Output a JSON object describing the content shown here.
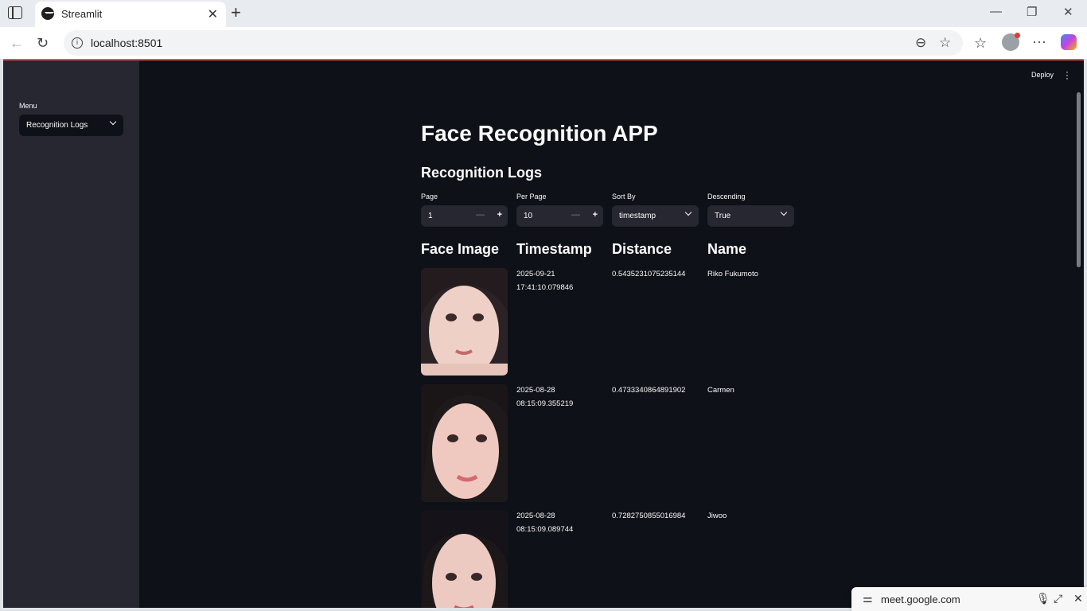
{
  "browser": {
    "tab_title": "Streamlit",
    "url": "localhost:8501",
    "toast_url": "meet.google.com"
  },
  "sidebar": {
    "menu_label": "Menu",
    "menu_selected": "Recognition Logs"
  },
  "header": {
    "deploy_label": "Deploy"
  },
  "main": {
    "title": "Face Recognition APP",
    "subtitle": "Recognition Logs",
    "controls": {
      "page_label": "Page",
      "page_value": "1",
      "per_page_label": "Per Page",
      "per_page_value": "10",
      "sort_by_label": "Sort By",
      "sort_by_value": "timestamp",
      "descending_label": "Descending",
      "descending_value": "True"
    },
    "columns": [
      "Face Image",
      "Timestamp",
      "Distance",
      "Name"
    ],
    "rows": [
      {
        "date": "2025-09-21",
        "time": "17:41:10.079846",
        "distance": "0.5435231075235144",
        "name": "Riko Fukumoto"
      },
      {
        "date": "2025-08-28",
        "time": "08:15:09.355219",
        "distance": "0.4733340864891902",
        "name": "Carmen"
      },
      {
        "date": "2025-08-28",
        "time": "08:15:09.089744",
        "distance": "0.7282750855016984",
        "name": "Jiwoo"
      }
    ]
  },
  "colors": {
    "app_bg": "#0e1117",
    "sidebar_bg": "#262730",
    "accent": "#ff4b4b",
    "text": "#fafafa"
  }
}
